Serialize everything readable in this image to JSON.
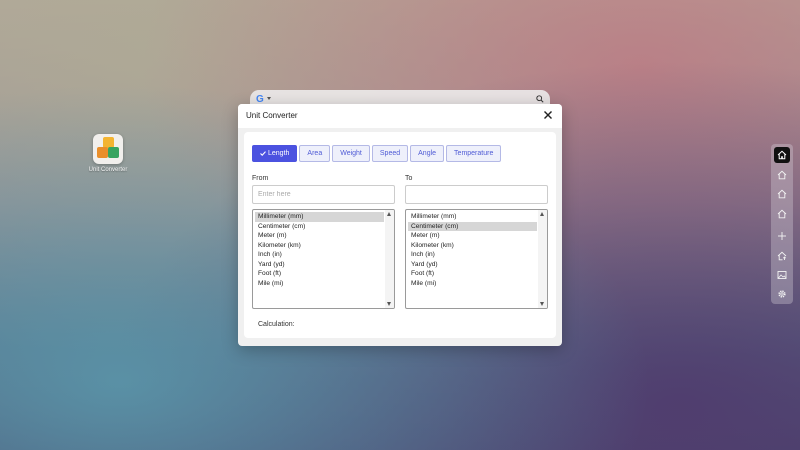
{
  "desktop": {
    "icon_label": "Unit Converter"
  },
  "dialog": {
    "title": "Unit Converter",
    "tabs": [
      {
        "label": "Length",
        "active": true
      },
      {
        "label": "Area",
        "active": false
      },
      {
        "label": "Weight",
        "active": false
      },
      {
        "label": "Speed",
        "active": false
      },
      {
        "label": "Angle",
        "active": false
      },
      {
        "label": "Temperature",
        "active": false
      }
    ],
    "from": {
      "label": "From",
      "placeholder": "Enter here",
      "value": "",
      "selected": "Millimeter (mm)"
    },
    "to": {
      "label": "To",
      "placeholder": "",
      "value": "",
      "selected": "Centimeter (cm)"
    },
    "units": [
      "Millimeter (mm)",
      "Centimeter (cm)",
      "Meter (m)",
      "Kilometer (km)",
      "Inch (in)",
      "Yard (yd)",
      "Foot (ft)",
      "Mile (mi)"
    ],
    "calculation_label": "Calculation:"
  },
  "dock": {
    "icons": [
      "home-icon",
      "home-icon",
      "home-icon",
      "home-icon",
      "plus-icon",
      "house-upload-icon",
      "image-icon",
      "gear-icon"
    ]
  },
  "colors": {
    "accent": "#4b52e0",
    "tab_border": "#b4b9e6",
    "tab_bg": "#eef0fb"
  }
}
